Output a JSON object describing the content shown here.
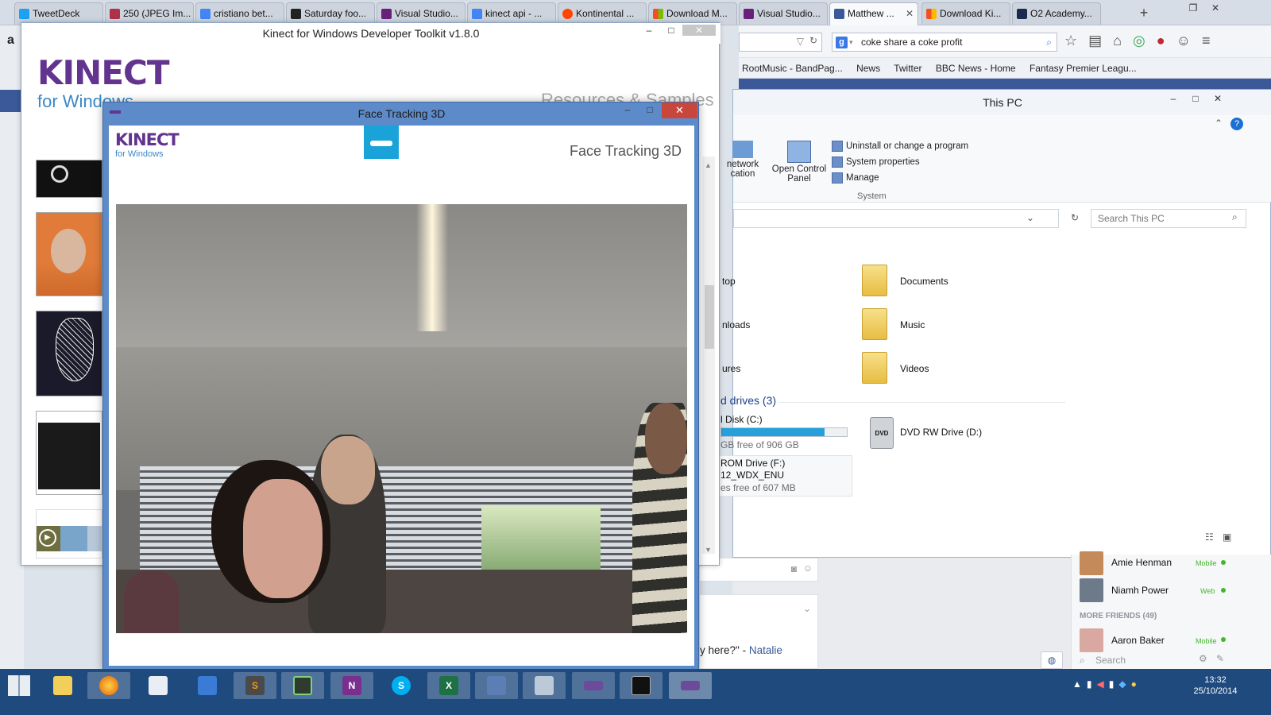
{
  "browser": {
    "tabs": [
      {
        "label": "TweetDeck"
      },
      {
        "label": "250 (JPEG Im..."
      },
      {
        "label": "cristiano bet..."
      },
      {
        "label": "Saturday foo..."
      },
      {
        "label": "Visual Studio..."
      },
      {
        "label": "kinect api - ..."
      },
      {
        "label": "Kontinental ..."
      },
      {
        "label": "Download M..."
      },
      {
        "label": "Visual Studio..."
      },
      {
        "label": "Matthew ..."
      },
      {
        "label": "Download Ki..."
      },
      {
        "label": "O2 Academy..."
      }
    ],
    "new_tab": "+",
    "search_text": "coke share a coke profit",
    "bookmarks": [
      "RootMusic - BandPag...",
      "News",
      "Twitter",
      "BBC News - Home",
      "Fantasy Premier Leagu..."
    ]
  },
  "toolkit": {
    "title": "Kinect for Windows Developer Toolkit v1.8.0",
    "logo_main": "KINECT",
    "logo_sub": "for Windows",
    "header_right": "Resources & Samples"
  },
  "explorer": {
    "title": "This PC",
    "ribbon": {
      "network": "network",
      "location": "cation",
      "open_control_panel": "Open Control",
      "open_control_panel_2": "Panel",
      "uninstall": "Uninstall or change a program",
      "system_properties": "System properties",
      "manage": "Manage",
      "group": "System"
    },
    "search_placeholder": "Search This PC",
    "folders_left": [
      "top",
      "nloads",
      "ures"
    ],
    "folders_right": [
      "Documents",
      "Music",
      "Videos"
    ],
    "drives_heading": "d drives (3)",
    "drive_c_name": "l Disk (C:)",
    "drive_c_free": "GB free of 906 GB",
    "drive_c_usage": 0.82,
    "drive_f_name": "ROM Drive (F:)",
    "drive_f_label": "12_WDX_ENU",
    "drive_f_free": "es free of 607 MB",
    "dvd": "DVD RW Drive (D:)",
    "dvd_badge": "DVD"
  },
  "facebook": {
    "friends": [
      {
        "name": "Amie Henman",
        "status": "Mobile"
      },
      {
        "name": "Niamh Power",
        "status": "Web"
      }
    ],
    "more_friends": "MORE FRIENDS (49)",
    "more": [
      {
        "name": "Aaron Baker",
        "status": "Mobile"
      }
    ],
    "search": "Search",
    "snippet": "y here?\" - ",
    "snippet_name": "Natalie"
  },
  "facetracking": {
    "title": "Face Tracking 3D",
    "logo_main": "KINECT",
    "logo_sub": "for Windows",
    "heading": "Face Tracking 3D"
  },
  "taskbar": {
    "time": "13:32",
    "date": "25/10/2014"
  },
  "colors": {
    "kinect_purple": "#62338f",
    "kinect_blue": "#3b89c7",
    "taskbar": "#1f4a7e",
    "facebook_blue": "#3b5998",
    "close_red": "#c9463d",
    "sensor_blue": "#1aa3d9"
  }
}
